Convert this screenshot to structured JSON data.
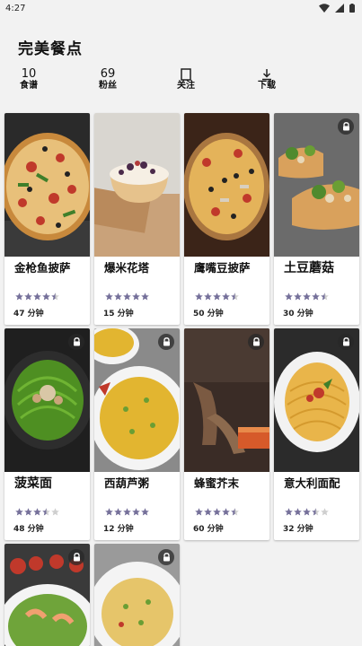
{
  "status_bar": {
    "time": "4:27"
  },
  "header": {
    "title": "完美餐点",
    "stats": [
      {
        "value": "10",
        "label": "食谱"
      },
      {
        "value": "69",
        "label": "粉丝"
      },
      {
        "value": "",
        "label": "关注",
        "icon": "bookmark-icon"
      },
      {
        "value": "",
        "label": "下载",
        "icon": "download-icon"
      }
    ]
  },
  "colors": {
    "star_filled": "#75709a",
    "star_empty": "#cfcfcf",
    "background": "#f2f2f2"
  },
  "recipes": [
    {
      "name": "金枪鱼披萨",
      "rating": 4.5,
      "time": "47 分钟",
      "locked": false,
      "image": "tuna-pizza"
    },
    {
      "name": "爆米花塔",
      "rating": 5,
      "time": "15 分钟",
      "locked": false,
      "image": "popcorn-tart"
    },
    {
      "name": "鹰嘴豆披萨",
      "rating": 4.5,
      "time": "50 分钟",
      "locked": false,
      "image": "chickpea-pizza"
    },
    {
      "name": "土豆蘑菇",
      "rating": 4.5,
      "time": "30 分钟",
      "locked": true,
      "image": "potato-mushroom"
    },
    {
      "name": "菠菜面",
      "rating": 3.5,
      "time": "48 分钟",
      "locked": true,
      "image": "spinach-noodles"
    },
    {
      "name": "西葫芦粥",
      "rating": 5,
      "time": "12 分钟",
      "locked": true,
      "image": "zucchini-porridge"
    },
    {
      "name": "蜂蜜芥末",
      "rating": 4.5,
      "time": "60 分钟",
      "locked": true,
      "image": "honey-mustard"
    },
    {
      "name": "意大利面配",
      "rating": 3.5,
      "time": "32 分钟",
      "locked": true,
      "image": "spaghetti"
    },
    {
      "name": "",
      "rating": 0,
      "time": "",
      "locked": true,
      "image": "shrimp-salad"
    },
    {
      "name": "",
      "rating": 0,
      "time": "",
      "locked": true,
      "image": "egg-scramble"
    }
  ]
}
